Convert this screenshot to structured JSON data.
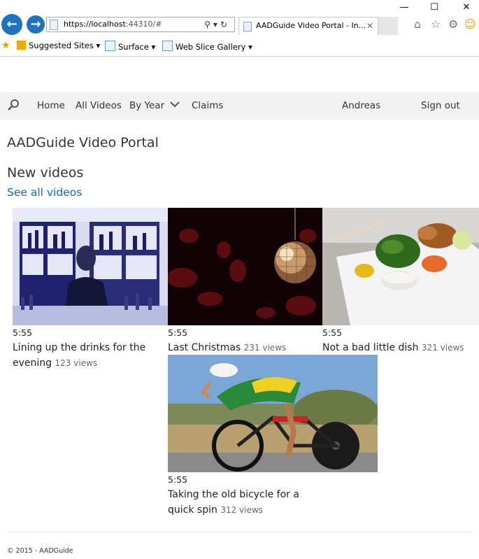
{
  "browser": {
    "address": {
      "host": "https://localhost",
      "rest": ":44310/#"
    },
    "tab_title": "AADGuide Video Portal - In...",
    "favorites": [
      "Suggested Sites",
      "Surface",
      "Web Slice Gallery"
    ]
  },
  "nav": {
    "home": "Home",
    "all_videos": "All Videos",
    "by_year": "By Year",
    "claims": "Claims",
    "user": "Andreas",
    "sign_out": "Sign out"
  },
  "page": {
    "site_title": "AADGuide Video Portal",
    "section_title": "New videos",
    "see_all": "See all videos"
  },
  "videos": [
    {
      "duration": "5:55",
      "title": "Lining up the drinks for the evening",
      "views": "123 views"
    },
    {
      "duration": "5:55",
      "title": "Last Christmas",
      "views": "231 views"
    },
    {
      "duration": "5:55",
      "title": "Not a bad little dish",
      "views": "321 views"
    },
    {
      "duration": "5:55",
      "title": "Taking the old bicycle for a quick spin",
      "views": "312 views"
    }
  ],
  "footer": "© 2015 - AADGuide",
  "colors": {
    "accent": "#0a6bb8",
    "nav_bg": "#f2f2f2",
    "browser_blue": "#1e73be"
  }
}
